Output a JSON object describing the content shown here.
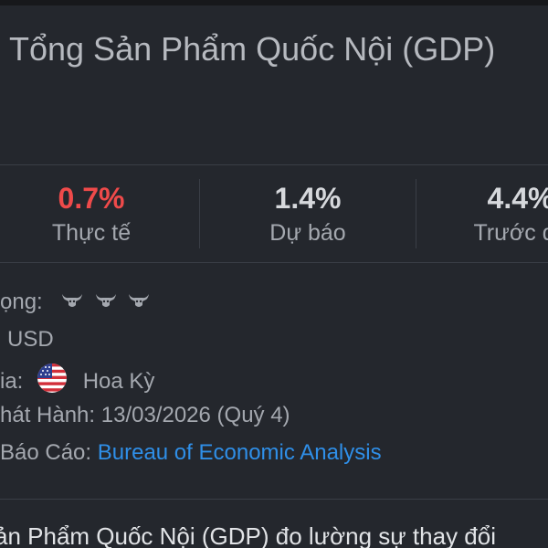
{
  "header": {
    "title": "Tổng Sản Phẩm Quốc Nội (GDP)"
  },
  "stats": {
    "actual": {
      "value": "0.7%",
      "label": "Thực tế",
      "color": "#ef4a4a"
    },
    "forecast": {
      "value": "1.4%",
      "label": "Dự báo",
      "color": "#d6d8dc"
    },
    "previous": {
      "value": "4.4%",
      "label": "Trước đó",
      "color": "#d6d8dc"
    }
  },
  "details": {
    "importance_label": "ọng:",
    "importance_icons": [
      "bull-icon",
      "bull-icon",
      "bull-icon"
    ],
    "currency": "USD",
    "country_label": "ia:",
    "country_flag_icon": "us-flag-icon",
    "country_value": "Hoa Kỳ",
    "release_label": "hát Hành:",
    "release_value": "13/03/2026 (Quý 4)",
    "source_label": "Báo Cáo:",
    "source_value": "Bureau of Economic Analysis"
  },
  "description": {
    "text": "ản Phẩm Quốc Nội (GDP) đo lường sự thay đổi"
  }
}
